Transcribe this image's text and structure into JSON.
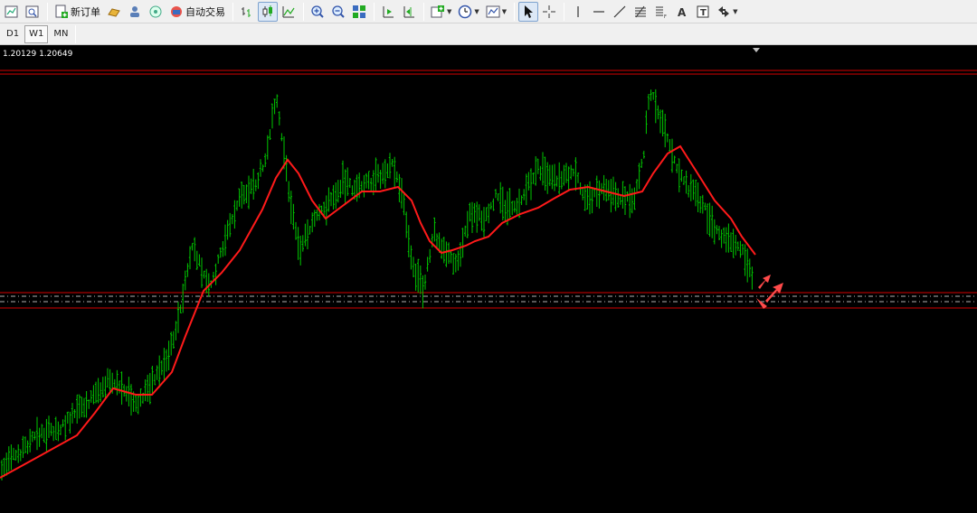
{
  "toolbar": {
    "new_order_label": "新订单",
    "auto_trading_label": "自动交易",
    "icons": [
      "new-chart-icon",
      "zoom-chart-icon",
      "new-order-icon",
      "gold-icon",
      "people-icon",
      "signal-icon",
      "auto-trading-icon",
      "bar-chart-icon",
      "candle-chart-icon",
      "line-chart-icon",
      "zoom-in-icon",
      "zoom-out-icon",
      "tile-icon",
      "autoscroll-icon",
      "chart-shift-icon",
      "indicators-icon",
      "periods-icon",
      "templates-icon",
      "cursor-icon",
      "crosshair-icon",
      "vertical-line-icon",
      "horizontal-line-icon",
      "trendline-icon",
      "fibonacci-icon",
      "fibo-fan-icon",
      "text-icon",
      "label-icon",
      "arrows-icon"
    ]
  },
  "timeframes": [
    {
      "label": "D1",
      "active": false
    },
    {
      "label": "W1",
      "active": true
    },
    {
      "label": "MN",
      "active": false
    }
  ],
  "chart": {
    "price_label": "1.20129 1.20649",
    "colors": {
      "background": "#000000",
      "bars": "#00c800",
      "moving_average": "#ff1a1a",
      "level_lines": "#d60000",
      "arrows": "#ff4a4a"
    }
  }
}
